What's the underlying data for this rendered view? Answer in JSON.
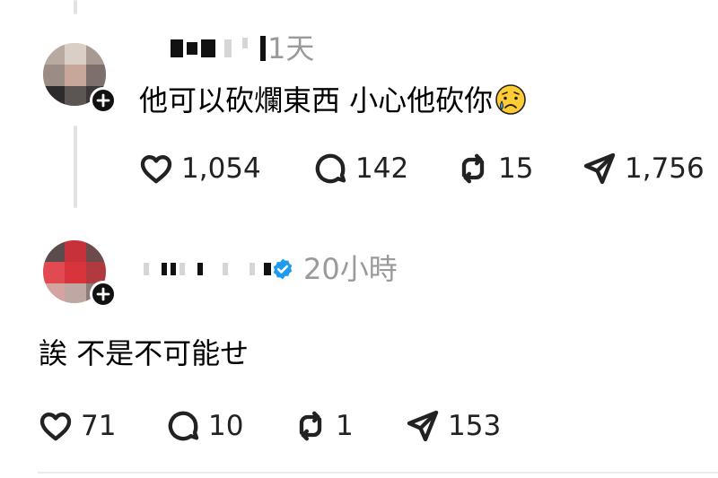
{
  "reply1": {
    "timestamp": "1天",
    "text": "他可以砍爛東西 小心他砍你",
    "emoji": "crying-face",
    "likes": "1,054",
    "comments": "142",
    "reposts": "15",
    "shares": "1,756"
  },
  "reply2": {
    "timestamp": "20小時",
    "verified": true,
    "text": "誒 不是不可能せ",
    "likes": "71",
    "comments": "10",
    "reposts": "1",
    "shares": "153"
  },
  "colors": {
    "verified_blue": "#1d9bf0",
    "timestamp_gray": "#9a9a9a",
    "thread_line": "#e3e3e3"
  }
}
